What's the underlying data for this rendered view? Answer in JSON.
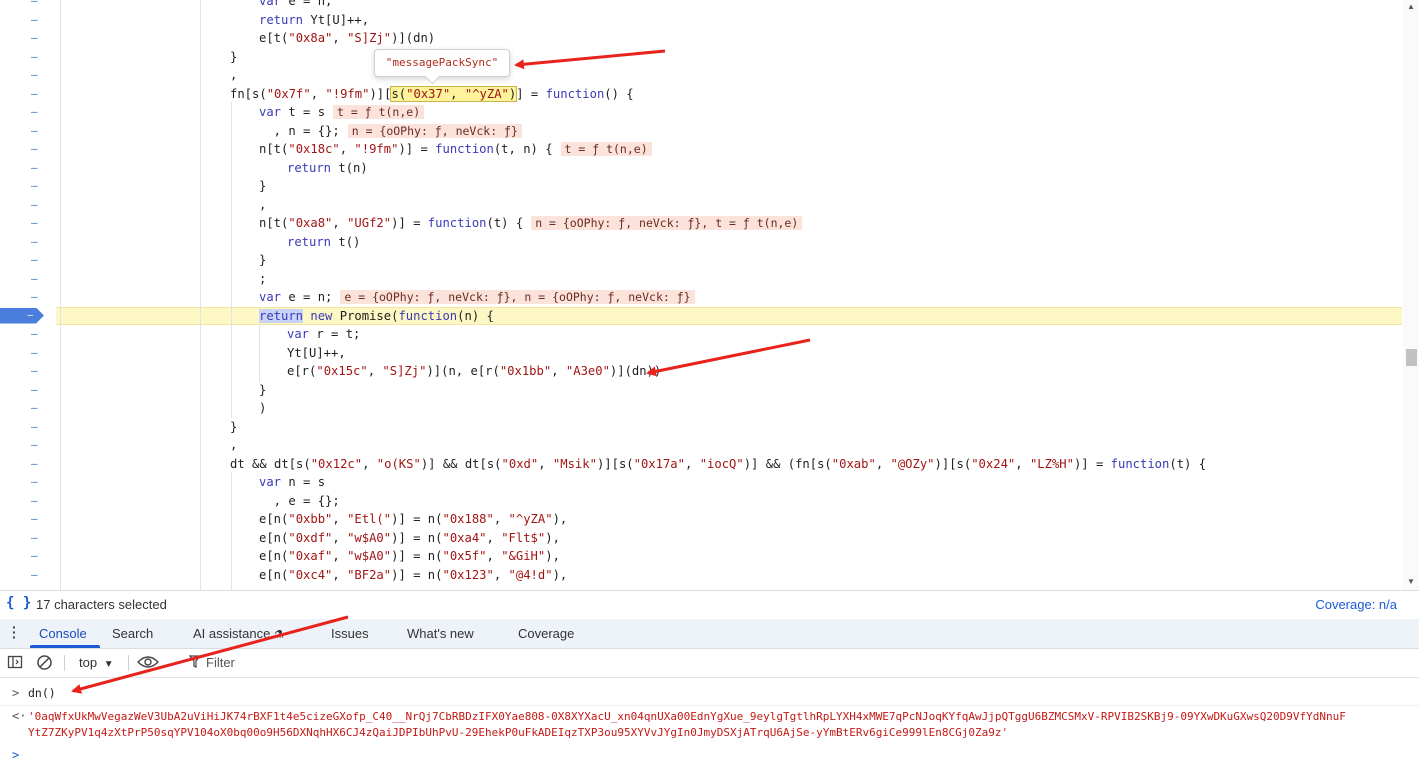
{
  "editor": {
    "lines": [
      {
        "text": "var e = n;",
        "indent": 259
      },
      {
        "text": "return Yt[U]++,",
        "indent": 259
      },
      {
        "text": "e[t(\"0x8a\", \"S]Zj\")](dn)",
        "indent": 259
      },
      {
        "text": "}",
        "indent": 230
      },
      {
        "text": ",",
        "indent": 230
      },
      {
        "text": "fn[s(\"0x7f\", \"!9fm\")][s(\"0x37\", \"^yZA\")] = function() {",
        "indent": 230
      },
      {
        "text": "var t = s",
        "indent": 259,
        "inline": "t = ƒ t(n,e)"
      },
      {
        "text": "  , n = {};",
        "indent": 259,
        "inline": "n = {oOPhy: ƒ, neVck: ƒ}"
      },
      {
        "text": "n[t(\"0x18c\", \"!9fm\")] = function(t, n) {",
        "indent": 259,
        "inline": "t = ƒ t(n,e)"
      },
      {
        "text": "return t(n)",
        "indent": 287
      },
      {
        "text": "}",
        "indent": 259
      },
      {
        "text": ",",
        "indent": 259
      },
      {
        "text": "n[t(\"0xa8\", \"UGf2\")] = function(t) {",
        "indent": 259,
        "inline": "n = {oOPhy: ƒ, neVck: ƒ}, t = ƒ t(n,e)"
      },
      {
        "text": "return t()",
        "indent": 287
      },
      {
        "text": "}",
        "indent": 259
      },
      {
        "text": ";",
        "indent": 259
      },
      {
        "text": "var e = n;",
        "indent": 259,
        "inline": "e = {oOPhy: ƒ, neVck: ƒ}, n = {oOPhy: ƒ, neVck: ƒ}"
      },
      {
        "text": "return new Promise(function(n) {",
        "indent": 259,
        "breakpoint": true
      },
      {
        "text": "var r = t;",
        "indent": 287
      },
      {
        "text": "Yt[U]++,",
        "indent": 287
      },
      {
        "text": "e[r(\"0x15c\", \"S]Zj\")](n, e[r(\"0x1bb\", \"A3e0\")](dn))",
        "indent": 287
      },
      {
        "text": "}",
        "indent": 259
      },
      {
        "text": ")",
        "indent": 259
      },
      {
        "text": "}",
        "indent": 230
      },
      {
        "text": ",",
        "indent": 230
      },
      {
        "text": "dt && dt[s(\"0x12c\", \"o(KS\")] && dt[s(\"0xd\", \"Msik\")][s(\"0x17a\", \"iocQ\")] && (fn[s(\"0xab\", \"@OZy\")][s(\"0x24\", \"LZ%H\")] = function(t) {",
        "indent": 230
      },
      {
        "text": "var n = s",
        "indent": 259
      },
      {
        "text": "  , e = {};",
        "indent": 259
      },
      {
        "text": "e[n(\"0xbb\", \"Etl(\")] = n(\"0x188\", \"^yZA\"),",
        "indent": 259
      },
      {
        "text": "e[n(\"0xdf\", \"w$A0\")] = n(\"0xa4\", \"Flt$\"),",
        "indent": 259
      },
      {
        "text": "e[n(\"0xaf\", \"w$A0\")] = n(\"0x5f\", \"&GiH\"),",
        "indent": 259
      },
      {
        "text": "e[n(\"0xc4\", \"BF2a\")] = n(\"0x123\", \"@4!d\"),",
        "indent": 259
      }
    ],
    "selected_expr": "s(\"0x37\", \"^yZA\")",
    "tooltip": "\"messagePackSync\"",
    "line_marker": "–",
    "breakpoint_dash": "–"
  },
  "statusbar": {
    "braces_icon": "{ }",
    "selection_text": "17 characters selected",
    "coverage_text": "Coverage: n/a"
  },
  "drawer": {
    "tabs": [
      {
        "label": "Console",
        "active": true
      },
      {
        "label": "Search"
      },
      {
        "label": "AI assistance"
      },
      {
        "label": "Issues"
      },
      {
        "label": "What's new"
      },
      {
        "label": "Coverage"
      }
    ]
  },
  "console_toolbar": {
    "context": "top",
    "filter_placeholder": "Filter"
  },
  "console": {
    "command": "dn()",
    "result_line1": "'0aqWfxUkMwVegazWeV3UbA2uViHiJK74rBXF1t4e5cizeGXofp_C40__NrQj7CbRBDzIFX0Yae808-0X8XYXacU_xn04qnUXa00EdnYgXue_9eylgTgtlhRpLYXH4xMWE7qPcNJoqKYfqAwJjpQTggU6BZMCSMxV-RPVIB2SKBj9-09YXwDKuGXwsQ20D9VfYdNnuF",
    "result_line2": "YtZ7ZKyPV1q4zXtPrP50sqYPV104oX0bq00o9H56DXNqhHX6CJ4zQaiJDPIbUhPvU-29EhekP0uFkADEIqzTXP3ou95XYVvJYgIn0JmyDSXjATrqU6AjSe-yYmBtERv6giCe999lEn8CGj0Za9z'"
  },
  "colors": {
    "accent": "#1a5ad7",
    "breakpoint": "#4a7ddc",
    "paused_line": "#fcf7c3",
    "inline_value_bg": "#fbe3dc",
    "arrow": "#e8231c"
  }
}
